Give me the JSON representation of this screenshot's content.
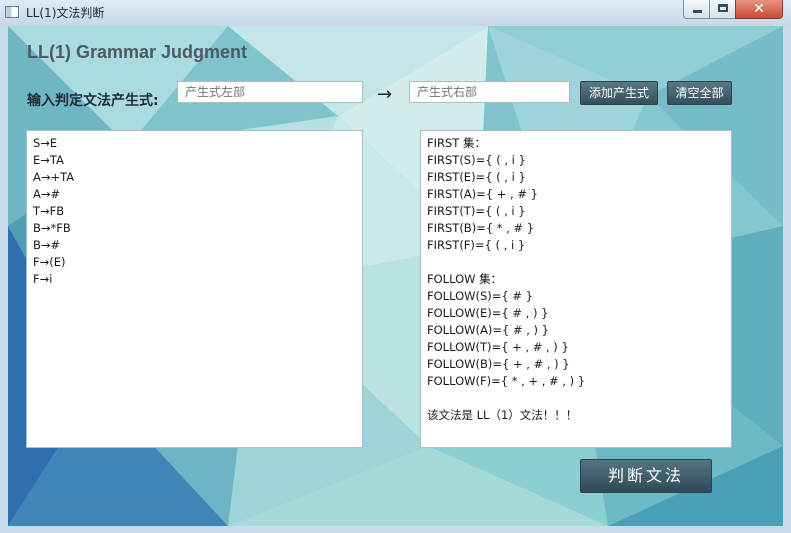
{
  "window": {
    "title": "LL(1)文法判断",
    "close_glyph": "✕"
  },
  "heading": "LL(1) Grammar Judgment",
  "prompt": "输入判定文法产生式:",
  "left_input": {
    "placeholder": "产生式左部"
  },
  "arrow": "→",
  "right_input": {
    "placeholder": "产生式右部"
  },
  "buttons": {
    "add": "添加产生式",
    "clear": "清空全部",
    "judge": "判断文法"
  },
  "productions": [
    "S→E",
    "E→TA",
    "A→+TA",
    "A→#",
    "T→FB",
    "B→*FB",
    "B→#",
    "F→(E)",
    "F→i"
  ],
  "result_lines": [
    "FIRST 集：",
    "FIRST(S)={ ( , i }",
    "FIRST(E)={ ( , i }",
    "FIRST(A)={ + , # }",
    "FIRST(T)={ ( , i }",
    "FIRST(B)={ * , # }",
    "FIRST(F)={ ( , i }",
    "",
    "FOLLOW 集：",
    "FOLLOW(S)={ # }",
    "FOLLOW(E)={ # , ) }",
    "FOLLOW(A)={ # , ) }",
    "FOLLOW(T)={ + , # , ) }",
    "FOLLOW(B)={ + , # , ) }",
    "FOLLOW(F)={ * , + , # , ) }",
    "",
    "该文法是 LL（1）文法！！！"
  ]
}
